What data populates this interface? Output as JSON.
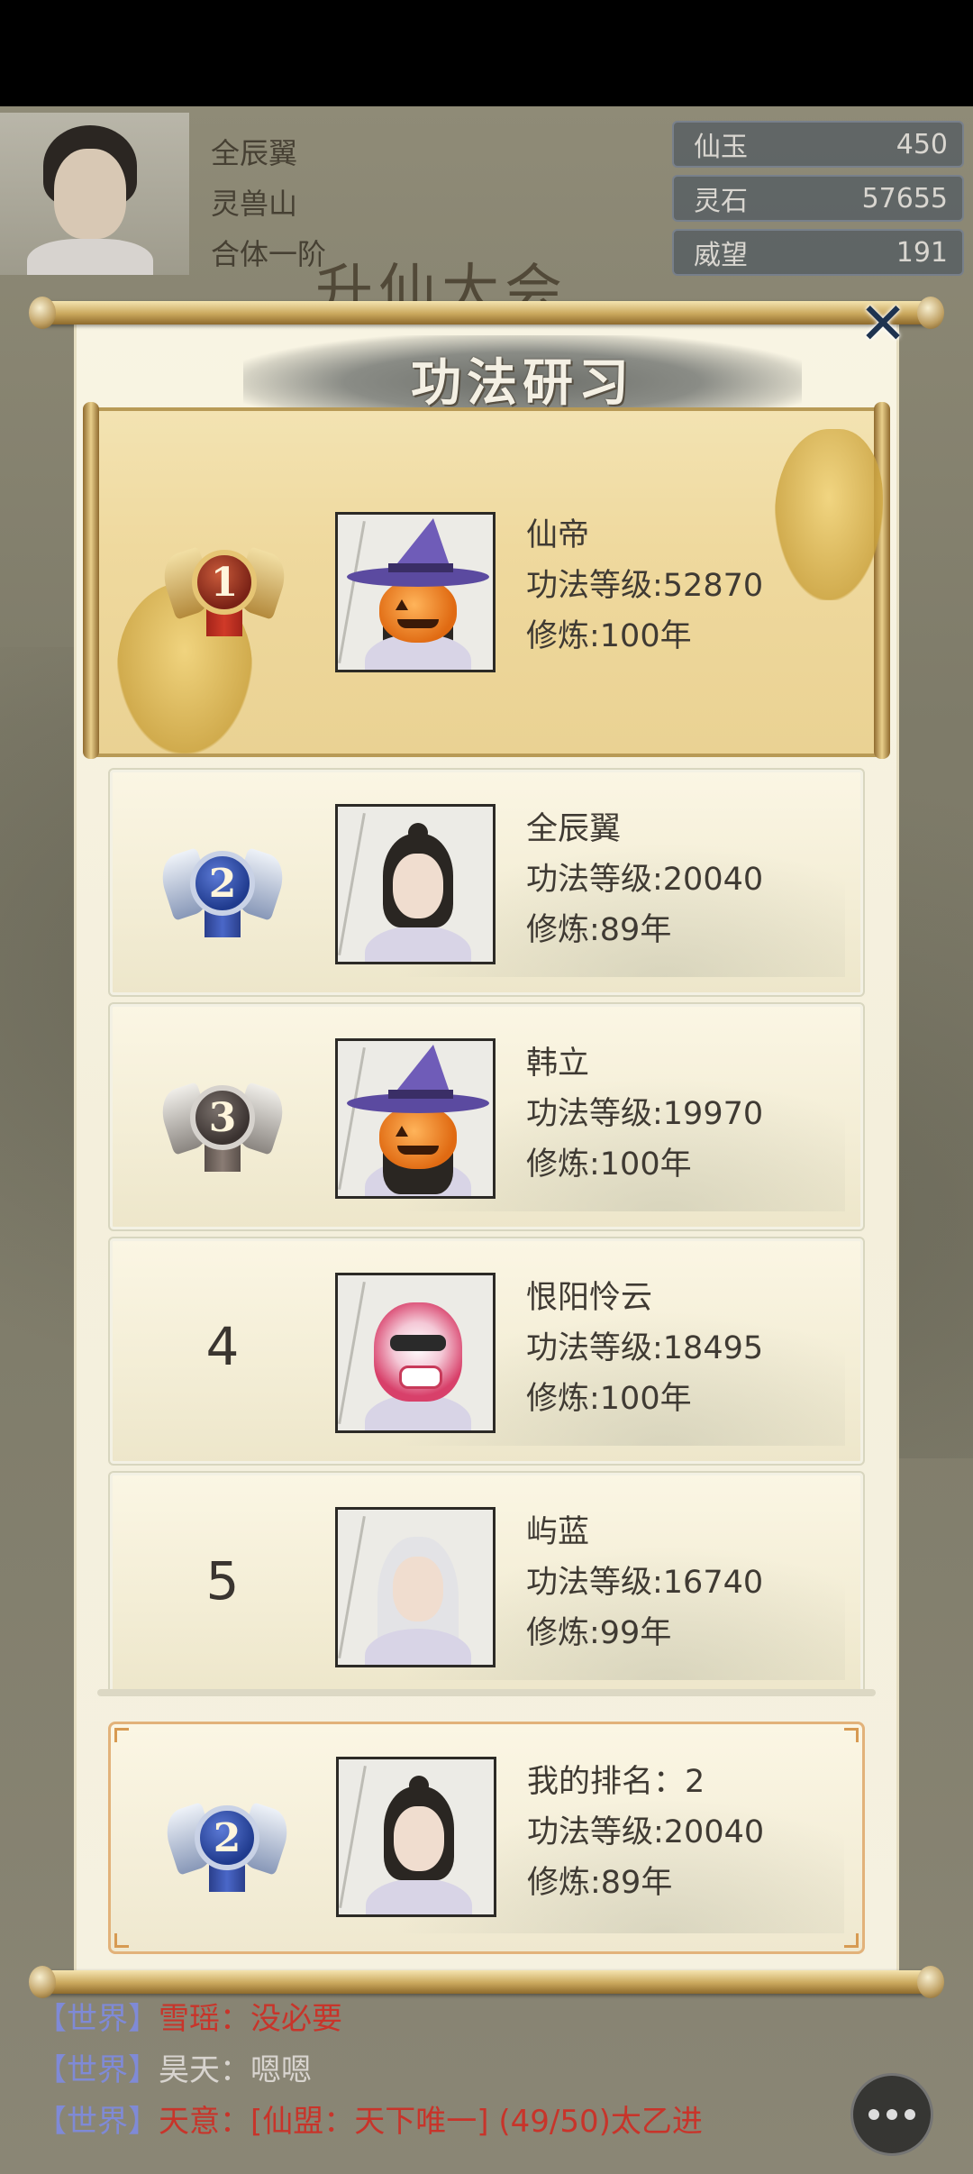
{
  "player": {
    "name": "全辰翼",
    "sect": "灵兽山",
    "realm": "合体一阶"
  },
  "resources": [
    {
      "label": "仙玉",
      "value": "450"
    },
    {
      "label": "灵石",
      "value": "57655"
    },
    {
      "label": "威望",
      "value": "191"
    }
  ],
  "event_title": "升仙大会",
  "dialog": {
    "title": "功法研习",
    "close_label": "✕",
    "first": {
      "rank": "1",
      "name": "仙帝",
      "level": "功法等级:52870",
      "cultivate": "修炼:100年"
    },
    "rows": [
      {
        "rank": "2",
        "name": "全辰翼",
        "level": "功法等级:20040",
        "cultivate": "修炼:89年"
      },
      {
        "rank": "3",
        "name": "韩立",
        "level": "功法等级:19970",
        "cultivate": "修炼:100年"
      },
      {
        "rank": "4",
        "name": "恨阳怜云",
        "level": "功法等级:18495",
        "cultivate": "修炼:100年"
      },
      {
        "rank": "5",
        "name": "屿蓝",
        "level": "功法等级:16740",
        "cultivate": "修炼:99年"
      }
    ],
    "mine": {
      "rank": "2",
      "label": "我的排名：2",
      "level": "功法等级:20040",
      "cultivate": "修炼:89年"
    }
  },
  "chat": [
    {
      "channel": "世界",
      "speaker": "雪瑶",
      "message": "没必要"
    },
    {
      "channel": "世界",
      "speaker": "昊天",
      "message": "嗯嗯"
    },
    {
      "channel": "世界",
      "speaker": "天意",
      "message": "[仙盟：天下唯一] (49/50)太乙进"
    }
  ],
  "colors": {
    "accent_gold": "#c9a75c",
    "chat_channel": "#7f8ad6",
    "chat_name": "#c8342a"
  }
}
